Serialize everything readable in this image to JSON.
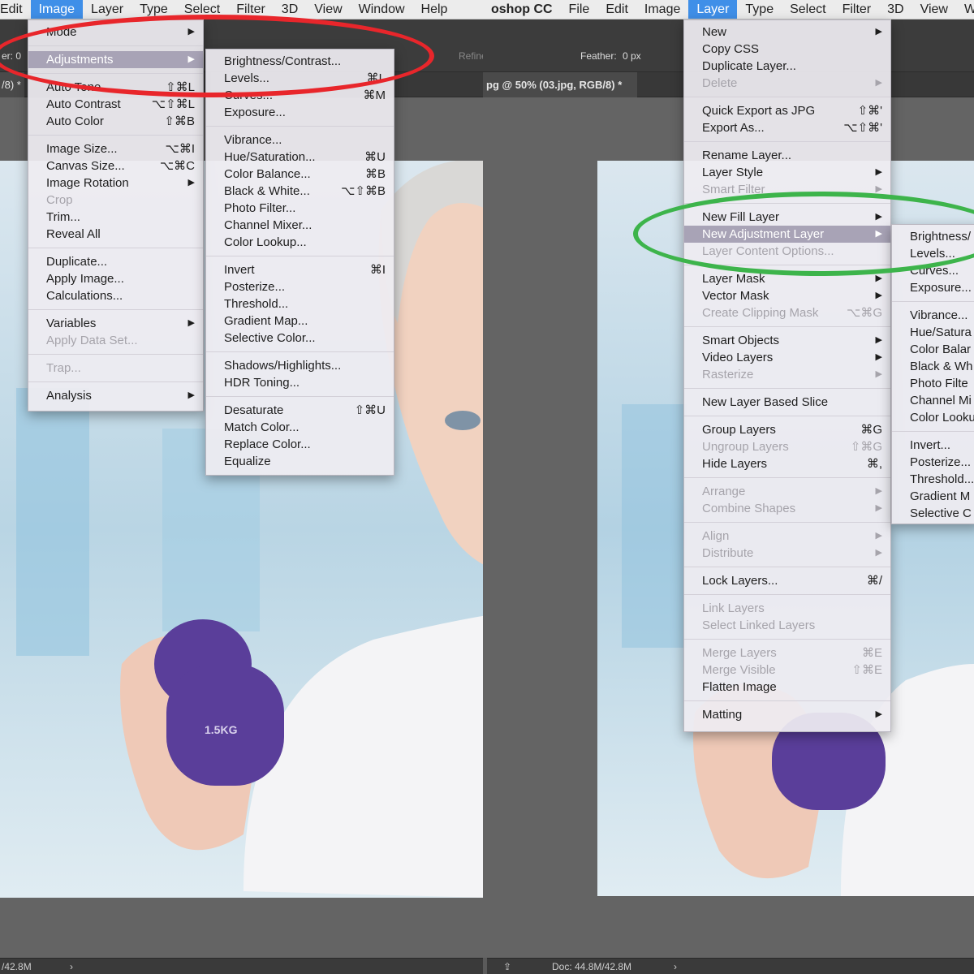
{
  "left": {
    "menubar": [
      "Edit",
      "Image",
      "Layer",
      "Type",
      "Select",
      "Filter",
      "3D",
      "View",
      "Window",
      "Help"
    ],
    "menubar_active": "Image",
    "options_text": "er: 0",
    "refine_label": "Refine",
    "tab_label": "/8) *",
    "status_text": "/42.8M",
    "photo_label": "1.5KG",
    "image_menu": [
      {
        "label": "Mode",
        "arrow": "▶"
      },
      {
        "sep": true
      },
      {
        "label": "Adjustments",
        "arrow": "▶",
        "highlight": true
      },
      {
        "sep": true
      },
      {
        "label": "Auto Tone",
        "sc": "⇧⌘L"
      },
      {
        "label": "Auto Contrast",
        "sc": "⌥⇧⌘L"
      },
      {
        "label": "Auto Color",
        "sc": "⇧⌘B"
      },
      {
        "sep": true
      },
      {
        "label": "Image Size...",
        "sc": "⌥⌘I"
      },
      {
        "label": "Canvas Size...",
        "sc": "⌥⌘C"
      },
      {
        "label": "Image Rotation",
        "arrow": "▶"
      },
      {
        "label": "Crop",
        "disabled": true
      },
      {
        "label": "Trim..."
      },
      {
        "label": "Reveal All"
      },
      {
        "sep": true
      },
      {
        "label": "Duplicate..."
      },
      {
        "label": "Apply Image..."
      },
      {
        "label": "Calculations..."
      },
      {
        "sep": true
      },
      {
        "label": "Variables",
        "arrow": "▶"
      },
      {
        "label": "Apply Data Set...",
        "disabled": true
      },
      {
        "sep": true
      },
      {
        "label": "Trap...",
        "disabled": true
      },
      {
        "sep": true
      },
      {
        "label": "Analysis",
        "arrow": "▶"
      }
    ],
    "adjust_menu": [
      {
        "label": "Brightness/Contrast..."
      },
      {
        "label": "Levels...",
        "sc": "⌘L"
      },
      {
        "label": "Curves...",
        "sc": "⌘M"
      },
      {
        "label": "Exposure..."
      },
      {
        "sep": true
      },
      {
        "label": "Vibrance..."
      },
      {
        "label": "Hue/Saturation...",
        "sc": "⌘U"
      },
      {
        "label": "Color Balance...",
        "sc": "⌘B"
      },
      {
        "label": "Black & White...",
        "sc": "⌥⇧⌘B"
      },
      {
        "label": "Photo Filter..."
      },
      {
        "label": "Channel Mixer..."
      },
      {
        "label": "Color Lookup..."
      },
      {
        "sep": true
      },
      {
        "label": "Invert",
        "sc": "⌘I"
      },
      {
        "label": "Posterize..."
      },
      {
        "label": "Threshold..."
      },
      {
        "label": "Gradient Map..."
      },
      {
        "label": "Selective Color..."
      },
      {
        "sep": true
      },
      {
        "label": "Shadows/Highlights..."
      },
      {
        "label": "HDR Toning..."
      },
      {
        "sep": true
      },
      {
        "label": "Desaturate",
        "sc": "⇧⌘U"
      },
      {
        "label": "Match Color..."
      },
      {
        "label": "Replace Color..."
      },
      {
        "label": "Equalize"
      }
    ]
  },
  "right": {
    "menubar": [
      "oshop CC",
      "File",
      "Edit",
      "Image",
      "Layer",
      "Type",
      "Select",
      "Filter",
      "3D",
      "View",
      "W"
    ],
    "menubar_app": "oshop CC",
    "menubar_active": "Layer",
    "feather_label": "Feather:",
    "feather_value": "0 px",
    "tab_label": "pg @ 50% (03.jpg, RGB/8) *",
    "status_text": "Doc: 44.8M/42.8M",
    "layer_menu": [
      {
        "label": "New",
        "arrow": "▶"
      },
      {
        "label": "Copy CSS"
      },
      {
        "label": "Duplicate Layer..."
      },
      {
        "label": "Delete",
        "arrow": "▶",
        "disabled": true
      },
      {
        "sep": true
      },
      {
        "label": "Quick Export as JPG",
        "sc": "⇧⌘'"
      },
      {
        "label": "Export As...",
        "sc": "⌥⇧⌘'"
      },
      {
        "sep": true
      },
      {
        "label": "Rename Layer..."
      },
      {
        "label": "Layer Style",
        "arrow": "▶"
      },
      {
        "label": "Smart Filter",
        "arrow": "▶",
        "disabled": true
      },
      {
        "sep": true
      },
      {
        "label": "New Fill Layer",
        "arrow": "▶"
      },
      {
        "label": "New Adjustment Layer",
        "arrow": "▶",
        "highlight": true
      },
      {
        "label": "Layer Content Options...",
        "disabled": true
      },
      {
        "sep": true
      },
      {
        "label": "Layer Mask",
        "arrow": "▶"
      },
      {
        "label": "Vector Mask",
        "arrow": "▶"
      },
      {
        "label": "Create Clipping Mask",
        "sc": "⌥⌘G",
        "disabled": true
      },
      {
        "sep": true
      },
      {
        "label": "Smart Objects",
        "arrow": "▶"
      },
      {
        "label": "Video Layers",
        "arrow": "▶"
      },
      {
        "label": "Rasterize",
        "arrow": "▶",
        "disabled": true
      },
      {
        "sep": true
      },
      {
        "label": "New Layer Based Slice"
      },
      {
        "sep": true
      },
      {
        "label": "Group Layers",
        "sc": "⌘G"
      },
      {
        "label": "Ungroup Layers",
        "sc": "⇧⌘G",
        "disabled": true
      },
      {
        "label": "Hide Layers",
        "sc": "⌘,"
      },
      {
        "sep": true
      },
      {
        "label": "Arrange",
        "arrow": "▶",
        "disabled": true
      },
      {
        "label": "Combine Shapes",
        "arrow": "▶",
        "disabled": true
      },
      {
        "sep": true
      },
      {
        "label": "Align",
        "arrow": "▶",
        "disabled": true
      },
      {
        "label": "Distribute",
        "arrow": "▶",
        "disabled": true
      },
      {
        "sep": true
      },
      {
        "label": "Lock Layers...",
        "sc": "⌘/"
      },
      {
        "sep": true
      },
      {
        "label": "Link Layers",
        "disabled": true
      },
      {
        "label": "Select Linked Layers",
        "disabled": true
      },
      {
        "sep": true
      },
      {
        "label": "Merge Layers",
        "sc": "⌘E",
        "disabled": true
      },
      {
        "label": "Merge Visible",
        "sc": "⇧⌘E",
        "disabled": true
      },
      {
        "label": "Flatten Image"
      },
      {
        "sep": true
      },
      {
        "label": "Matting",
        "arrow": "▶"
      }
    ],
    "adjust_menu": [
      {
        "label": "Brightness/"
      },
      {
        "label": "Levels..."
      },
      {
        "label": "Curves..."
      },
      {
        "label": "Exposure..."
      },
      {
        "sep": true
      },
      {
        "label": "Vibrance..."
      },
      {
        "label": "Hue/Satura"
      },
      {
        "label": "Color Balar"
      },
      {
        "label": "Black & Wh"
      },
      {
        "label": "Photo Filte"
      },
      {
        "label": "Channel Mi"
      },
      {
        "label": "Color Looku"
      },
      {
        "sep": true
      },
      {
        "label": "Invert..."
      },
      {
        "label": "Posterize..."
      },
      {
        "label": "Threshold..."
      },
      {
        "label": "Gradient M"
      },
      {
        "label": "Selective C"
      }
    ]
  },
  "colors": {
    "highlight_red": "#e8262b",
    "highlight_green": "#3db44b",
    "menu_active": "#3f8fe8",
    "dumbbell": "#5a3e9a"
  }
}
